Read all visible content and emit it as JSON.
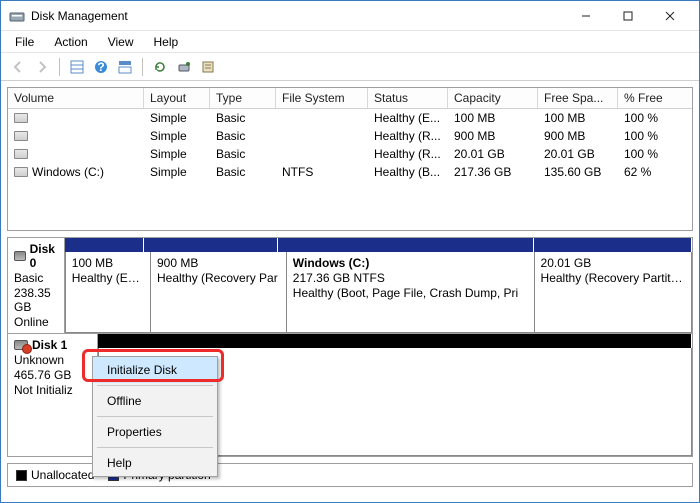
{
  "title": "Disk Management",
  "menus": [
    "File",
    "Action",
    "View",
    "Help"
  ],
  "columns": [
    "Volume",
    "Layout",
    "Type",
    "File System",
    "Status",
    "Capacity",
    "Free Spa...",
    "% Free"
  ],
  "rows": [
    {
      "vol": "",
      "layout": "Simple",
      "type": "Basic",
      "fs": "",
      "status": "Healthy (E...",
      "cap": "100 MB",
      "free": "100 MB",
      "pct": "100 %"
    },
    {
      "vol": "",
      "layout": "Simple",
      "type": "Basic",
      "fs": "",
      "status": "Healthy (R...",
      "cap": "900 MB",
      "free": "900 MB",
      "pct": "100 %"
    },
    {
      "vol": "",
      "layout": "Simple",
      "type": "Basic",
      "fs": "",
      "status": "Healthy (R...",
      "cap": "20.01 GB",
      "free": "20.01 GB",
      "pct": "100 %"
    },
    {
      "vol": "Windows (C:)",
      "layout": "Simple",
      "type": "Basic",
      "fs": "NTFS",
      "status": "Healthy (B...",
      "cap": "217.36 GB",
      "free": "135.60 GB",
      "pct": "62 %"
    }
  ],
  "disks": [
    {
      "name": "Disk 0",
      "type": "Basic",
      "size": "238.35 GB",
      "state": "Online",
      "err": false,
      "stripColor": "#1a2e8a",
      "parts": [
        {
          "flex": 80,
          "name": "",
          "l1": "100 MB",
          "l2": "Healthy (EFI S"
        },
        {
          "flex": 136,
          "name": "",
          "l1": "900 MB",
          "l2": "Healthy (Recovery Par"
        },
        {
          "flex": 260,
          "name": "Windows  (C:)",
          "l1": "217.36 GB NTFS",
          "l2": "Healthy (Boot, Page File, Crash Dump, Pri"
        },
        {
          "flex": 160,
          "name": "",
          "l1": "20.01 GB",
          "l2": "Healthy (Recovery Partition)"
        }
      ]
    },
    {
      "name": "Disk 1",
      "type": "Unknown",
      "size": "465.76 GB",
      "state": "Not Initializ",
      "err": true,
      "stripColor": "#000000",
      "parts": [
        {
          "flex": 1,
          "name": "",
          "l1": "",
          "l2": ""
        }
      ]
    }
  ],
  "legend": {
    "unalloc": "Unallocated",
    "primary": "Primary partition"
  },
  "ctx": {
    "items": [
      "Initialize Disk",
      "Offline",
      "Properties",
      "Help"
    ],
    "selected": 0
  },
  "colors": {
    "unalloc": "#000000",
    "primary": "#1a2e8a"
  }
}
